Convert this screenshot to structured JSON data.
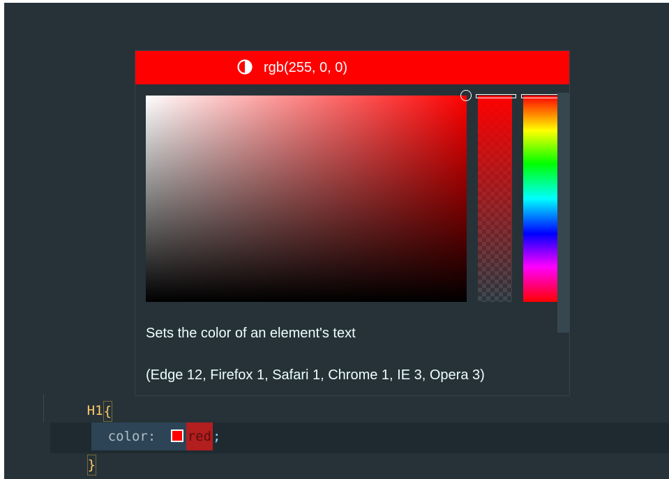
{
  "editor": {
    "lines": {
      "selector": "H1",
      "open_brace": "{",
      "property": "color: ",
      "value": "red",
      "semicolon": ";",
      "close_brace": "}"
    }
  },
  "color_picker": {
    "color_string": "rgb(255, 0, 0)",
    "current_color": "#ff0000",
    "icon": "contrast-icon"
  },
  "hover": {
    "description": "Sets the color of an element's text",
    "compatibility": "(Edge 12, Firefox 1, Safari 1, Chrome 1, IE 3, Opera 3)"
  },
  "colors": {
    "editor_bg": "#263238",
    "selector": "#ffcb6b",
    "accent": "#ff0000"
  }
}
